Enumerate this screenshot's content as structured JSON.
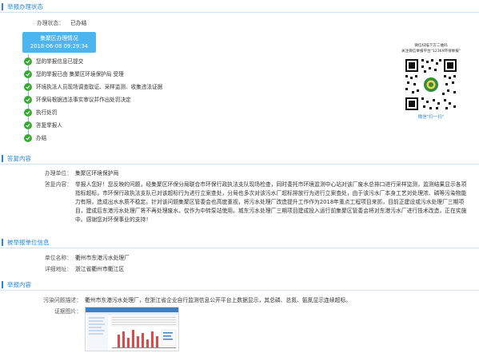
{
  "sections": {
    "status_title": "举报办理状态",
    "reply_title": "答复内容",
    "unit_title": "被举报单位信息",
    "report_title": "举报内容"
  },
  "status": {
    "label": "办理状态：",
    "value": "已办结"
  },
  "progress_card": {
    "title": "集聚区办理情况",
    "datetime": "2018-06-08 09:29:34"
  },
  "steps": [
    {
      "label": "您的举报信息已提交"
    },
    {
      "label": "您的举报已由 集聚区环境保护局 受理"
    },
    {
      "label": "环境执法人员现场调查取证、采样监测、收集违法证据"
    },
    {
      "label": "环保局根据违法事实审议并作出处罚决定"
    },
    {
      "label": "执行处罚"
    },
    {
      "label": "答复举报人"
    },
    {
      "label": "办结"
    }
  ],
  "qr": {
    "line1": "微信扫描下方二维码",
    "line2": "关注微信举报平台\"12369环保举报\"",
    "footer": "微信\"扫一扫\""
  },
  "reply": {
    "unit_label": "办理单位：",
    "unit_value": "集聚区环境保护局",
    "content_label": "答复内容：",
    "content_value": "举报人您好！您反映的问题，经集聚区环保分局联合市环保行政执法支队现场检查，同时委托市环境监测中心站对该厂废水总排口进行采样监测，监测结果显示各项指标超标，市环保行政执法支队已对该超标行为进行立案查处，分局也多次对该污水厂超标排放行为进行立案查处，由于该污水厂本身工艺对处理浓、磷等污染物能力有限，造成出水水质不稳定。针对该问题集聚区管委会也高度重视，将污水处理厂改造提升工作作为2018年重点工程项目来抓，目前正建设或污水处理厂三期项目，建成后东港污水处理厂将不再处理废水，仅作为中转泵站使用。城东污水处理厂三期项目建成投入运行前集聚区管委会将对东港污水厂进行技术改造，正在实施中。感谢您对环保事业的支持！"
  },
  "unit": {
    "name_label": "单位名称：",
    "name_value": "衢州市东港污水处理厂",
    "address_label": "详细地址：",
    "address_value": "浙江省衢州市衢江区"
  },
  "report": {
    "desc_label": "污染问题描述：",
    "desc_value": "衢州市东港污水处理厂，在浙江省企业自行监测信息公开平台上数据显示，其总磷、总氮、氨氮显示连续超标。",
    "evidence_label": "证据图片："
  },
  "colors": {
    "accent": "#2a87d6",
    "card": "#4db5ee",
    "step_dot": "#3aaa35",
    "line": "#79c4f0"
  }
}
